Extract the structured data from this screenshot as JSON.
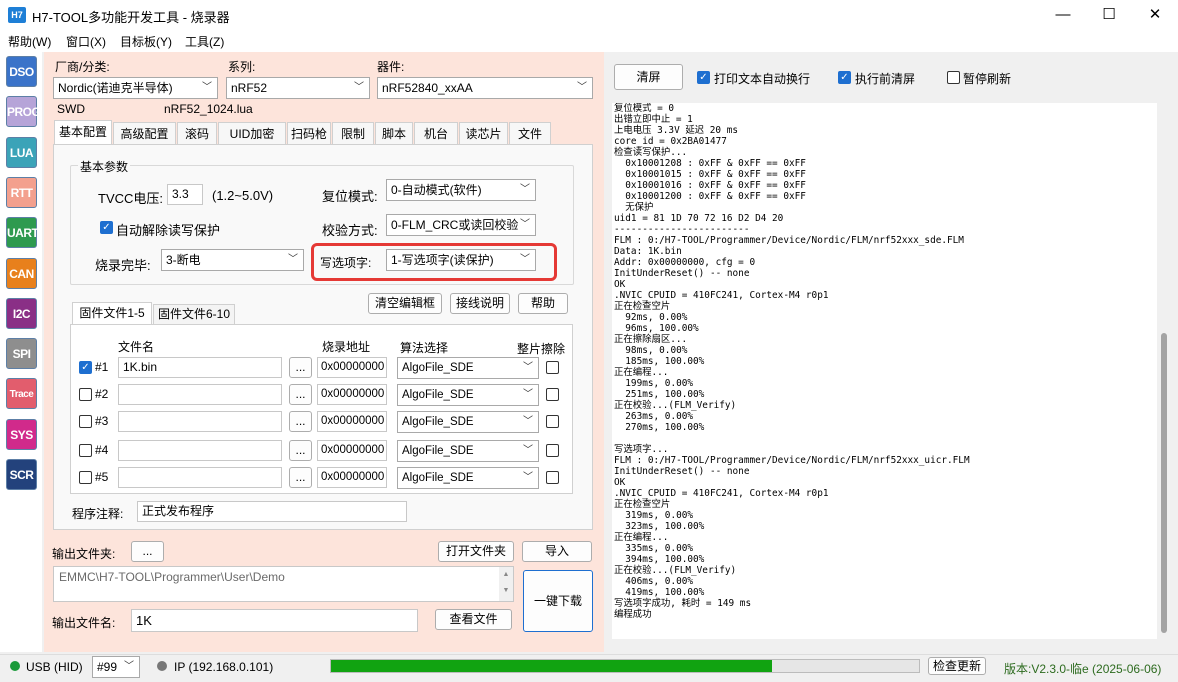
{
  "window": {
    "app_icon_text": "H7",
    "title": "H7-TOOL多功能开发工具 - 烧录器",
    "minimize": "—",
    "maximize": "☐",
    "close": "✕"
  },
  "menu": [
    "帮助(W)",
    "窗口(X)",
    "目标板(Y)",
    "工具(Z)"
  ],
  "sidebar": [
    {
      "label": "DSO",
      "color": "#3a73c9"
    },
    {
      "label": "PROG",
      "color": "#b6a4d8"
    },
    {
      "label": "LUA",
      "color": "#3ba3b8"
    },
    {
      "label": "RTT",
      "color": "#f3a08e"
    },
    {
      "label": "UART",
      "color": "#2e9a4f"
    },
    {
      "label": "CAN",
      "color": "#e8801c"
    },
    {
      "label": "I2C",
      "color": "#8a2f86"
    },
    {
      "label": "SPI",
      "color": "#8e8e8e"
    },
    {
      "label": "Trace",
      "color": "#e25d6d"
    },
    {
      "label": "SYS",
      "color": "#d12a8b"
    },
    {
      "label": "SCR",
      "color": "#23427c"
    }
  ],
  "selection": {
    "vendor_label": "厂商/分类:",
    "vendor_value": "Nordic(诺迪克半导体)",
    "series_label": "系列:",
    "series_value": "nRF52",
    "device_label": "器件:",
    "device_value": "nRF52840_xxAA",
    "interface": "SWD",
    "lua_file": "nRF52_1024.lua"
  },
  "tabs": [
    "基本配置",
    "高级配置",
    "滚码",
    "UID加密",
    "扫码枪",
    "限制",
    "脚本",
    "机台",
    "读芯片",
    "文件"
  ],
  "basic": {
    "group_title": "基本参数",
    "tvcc_label": "TVCC电压:",
    "tvcc_value": "3.3",
    "tvcc_range": "(1.2~5.0V)",
    "reset_label": "复位模式:",
    "reset_value": "0-自动模式(软件)",
    "auto_unprotect_label": "自动解除读写保护",
    "verify_label": "校验方式:",
    "verify_value": "0-FLM_CRC或读回校验",
    "after_label": "烧录完毕:",
    "after_value": "3-断电",
    "option_label": "写选项字:",
    "option_value": "1-写选项字(读保护)",
    "highlight_color": "#e53935"
  },
  "file_buttons": {
    "clear": "清空编辑框",
    "wiring": "接线说明",
    "help": "帮助"
  },
  "file_tabs": [
    "固件文件1-5",
    "固件文件6-10"
  ],
  "file_table": {
    "col_name": "文件名",
    "col_addr": "烧录地址",
    "col_algo": "算法选择",
    "col_erase": "整片擦除",
    "browse": "...",
    "rows": [
      {
        "num": "#1",
        "checked": true,
        "file": "1K.bin",
        "addr": "0x00000000",
        "algo": "AlgoFile_SDE"
      },
      {
        "num": "#2",
        "checked": false,
        "file": "",
        "addr": "0x00000000",
        "algo": "AlgoFile_SDE"
      },
      {
        "num": "#3",
        "checked": false,
        "file": "",
        "addr": "0x00000000",
        "algo": "AlgoFile_SDE"
      },
      {
        "num": "#4",
        "checked": false,
        "file": "",
        "addr": "0x00000000",
        "algo": "AlgoFile_SDE"
      },
      {
        "num": "#5",
        "checked": false,
        "file": "",
        "addr": "0x00000000",
        "algo": "AlgoFile_SDE"
      }
    ]
  },
  "program_note_label": "程序注释:",
  "program_note_value": "正式发布程序",
  "output": {
    "folder_label": "输出文件夹:",
    "folder_browse": "...",
    "open_folder": "打开文件夹",
    "import": "导入",
    "path": "EMMC\\H7-TOOL\\Programmer\\User\\Demo",
    "one_click": "一键下载",
    "file_label": "输出文件名:",
    "file_value": "1K",
    "view_file": "查看文件"
  },
  "right_toolbar": {
    "clear": "清屏",
    "wrap_label": "打印文本自动换行",
    "wrap": true,
    "clear_before_label": "执行前清屏",
    "clear_before": true,
    "pause_label": "暂停刷新",
    "pause": false
  },
  "log": "复位模式 = 0\n出错立即中止 = 1\n上电电压 3.3V 延迟 20 ms\ncore_id = 0x2BA01477\n检查读写保护...\n  0x10001208 : 0xFF & 0xFF == 0xFF\n  0x10001015 : 0xFF & 0xFF == 0xFF\n  0x10001016 : 0xFF & 0xFF == 0xFF\n  0x10001200 : 0xFF & 0xFF == 0xFF\n  无保护\nuid1 = 81 1D 70 72 16 D2 D4 20\n------------------------\nFLM : 0:/H7-TOOL/Programmer/Device/Nordic/FLM/nrf52xxx_sde.FLM\nData: 1K.bin\nAddr: 0x00000000, cfg = 0\nInitUnderReset() -- none\nOK\n.NVIC_CPUID = 410FC241, Cortex-M4 r0p1\n正在检查空片\n  92ms, 0.00%\n  96ms, 100.00%\n正在擦除扇区...\n  98ms, 0.00%\n  185ms, 100.00%\n正在编程...\n  199ms, 0.00%\n  251ms, 100.00%\n正在校验...(FLM_Verify)\n  263ms, 0.00%\n  270ms, 100.00%\n\n写选项字...\nFLM : 0:/H7-TOOL/Programmer/Device/Nordic/FLM/nrf52xxx_uicr.FLM\nInitUnderReset() -- none\nOK\n.NVIC_CPUID = 410FC241, Cortex-M4 r0p1\n正在检查空片\n  319ms, 0.00%\n  323ms, 100.00%\n正在编程...\n  335ms, 0.00%\n  394ms, 100.00%\n正在校验...(FLM_Verify)\n  406ms, 0.00%\n  419ms, 100.00%\n写选项字成功, 耗时 = 149 ms\n编程成功",
  "status": {
    "usb": "USB (HID)",
    "port": "#99",
    "ip": "IP (192.168.0.101)",
    "progress": 0.75,
    "progress_color": "#11a311",
    "check_update": "检查更新",
    "version": "版本:V2.3.0-临e (2025-06-06)"
  }
}
